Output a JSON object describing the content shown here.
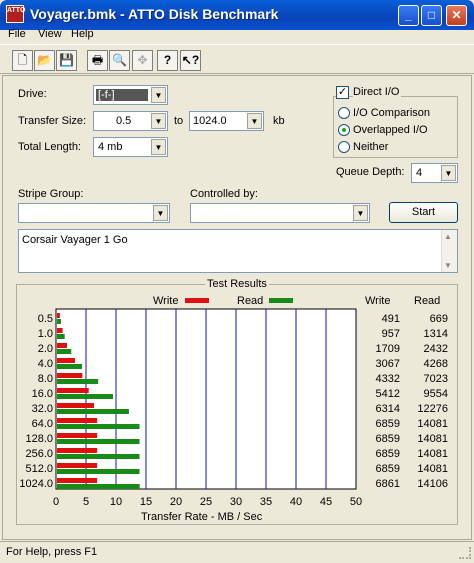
{
  "window": {
    "title": "Voyager.bmk - ATTO Disk Benchmark",
    "icon_text": "ATTO"
  },
  "menu": {
    "items": [
      "File",
      "View",
      "Help"
    ]
  },
  "toolbar": {
    "icons": [
      "new-icon",
      "open-icon",
      "save-icon",
      "print-icon",
      "print-preview-icon",
      "move-icon",
      "help-icon",
      "context-help-icon"
    ]
  },
  "settings": {
    "drive_label": "Drive:",
    "drive_value": "[-f-]",
    "transfer_size_label": "Transfer Size:",
    "transfer_from": "0.5",
    "to_label": "to",
    "transfer_to": "1024.0",
    "kb_label": "kb",
    "total_length_label": "Total Length:",
    "total_length_value": "4 mb",
    "direct_io_label": "Direct I/O",
    "direct_io_checked": true,
    "io_comparison_label": "I/O Comparison",
    "overlapped_io_label": "Overlapped I/O",
    "neither_label": "Neither",
    "selected_mode": "overlapped",
    "queue_depth_label": "Queue Depth:",
    "queue_depth_value": "4",
    "stripe_group_label": "Stripe Group:",
    "stripe_group_value": "",
    "controlled_by_label": "Controlled by:",
    "controlled_by_value": "",
    "start_label": "Start",
    "description": "Corsair Vayager 1 Go"
  },
  "results": {
    "group_title": "Test Results",
    "write_legend": "Write",
    "read_legend": "Read",
    "write_header": "Write",
    "read_header": "Read",
    "xlabel": "Transfer Rate - MB / Sec"
  },
  "colors": {
    "write": "#e01010",
    "read": "#178a17",
    "grid": "#1010c0"
  },
  "chart_data": {
    "type": "bar",
    "orientation": "horizontal",
    "categories": [
      "0.5",
      "1.0",
      "2.0",
      "4.0",
      "8.0",
      "16.0",
      "32.0",
      "64.0",
      "128.0",
      "256.0",
      "512.0",
      "1024.0"
    ],
    "series": [
      {
        "name": "Write",
        "values": [
          491,
          957,
          1709,
          3067,
          4332,
          5412,
          6314,
          6859,
          6859,
          6859,
          6859,
          6861
        ]
      },
      {
        "name": "Read",
        "values": [
          669,
          1314,
          2432,
          4268,
          7023,
          9554,
          12276,
          14081,
          14081,
          14081,
          14081,
          14106
        ]
      }
    ],
    "units_values": "KB/s",
    "xlabel": "Transfer Rate - MB / Sec",
    "xlim": [
      0,
      50
    ],
    "xticks": [
      "0",
      "5",
      "10",
      "15",
      "20",
      "25",
      "30",
      "35",
      "40",
      "45",
      "50"
    ],
    "grid": true,
    "legend": "top"
  },
  "status": {
    "text": "For Help, press F1"
  }
}
